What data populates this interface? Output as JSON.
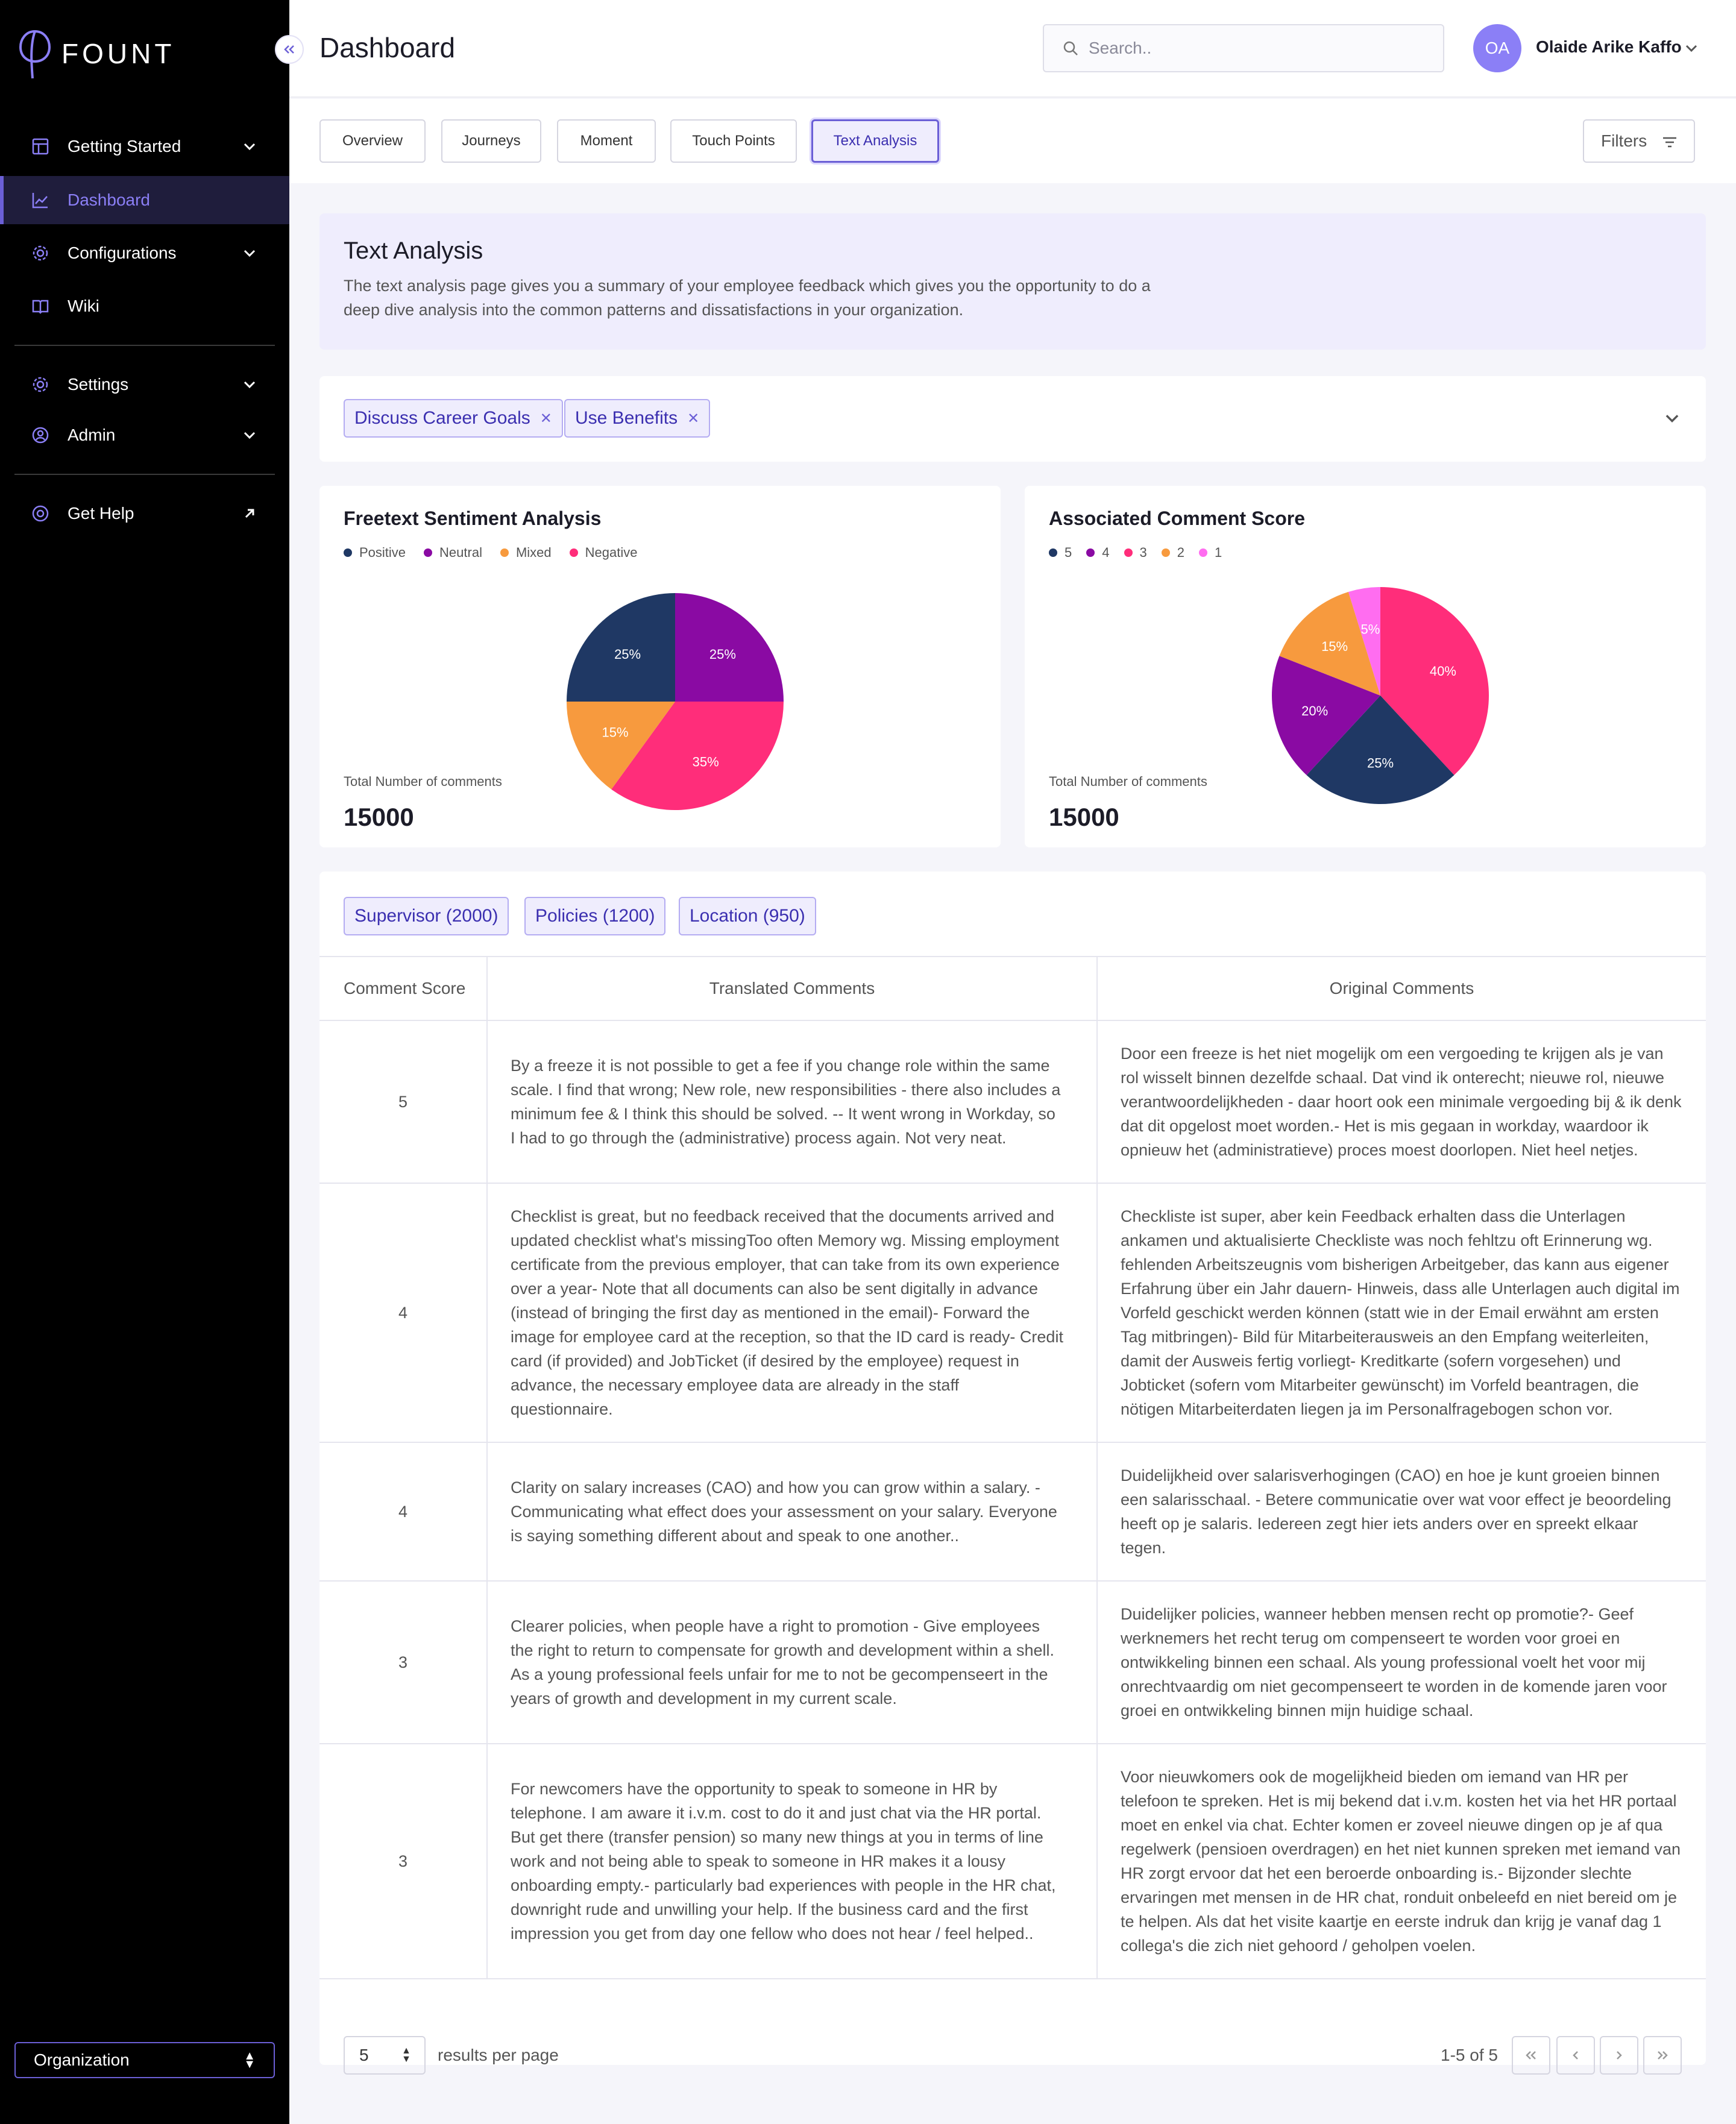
{
  "sidebar": {
    "logo_text": "FOUNT",
    "items": [
      {
        "label": "Getting Started"
      },
      {
        "label": "Dashboard"
      },
      {
        "label": "Configurations"
      },
      {
        "label": "Wiki"
      },
      {
        "label": "Settings"
      },
      {
        "label": "Admin"
      },
      {
        "label": "Get Help"
      }
    ],
    "org_select": "Organization"
  },
  "header": {
    "title": "Dashboard",
    "search_placeholder": "Search..",
    "avatar_initials": "OA",
    "user_name": "Olaide Arike Kaffo"
  },
  "tabs": [
    {
      "label": "Overview"
    },
    {
      "label": "Journeys"
    },
    {
      "label": "Moment"
    },
    {
      "label": "Touch Points"
    },
    {
      "label": "Text Analysis"
    }
  ],
  "filters_label": "Filters",
  "intro": {
    "title": "Text Analysis",
    "text": "The text analysis page gives you a summary of your employee feedback which gives you the opportunity to do a deep dive analysis into the common patterns and dissatisfactions in your organization."
  },
  "filter_chips": [
    "Discuss Career Goals",
    "Use Benefits"
  ],
  "chart_data": [
    {
      "type": "pie",
      "title": "Freetext Sentiment Analysis",
      "categories": [
        "Positive",
        "Neutral",
        "Mixed",
        "Negative"
      ],
      "values": [
        25,
        25,
        15,
        35
      ],
      "colors": [
        "#1f3864",
        "#8a0aa3",
        "#f79a3e",
        "#ff2d7a"
      ],
      "total_label": "Total Number of comments",
      "total": "15000"
    },
    {
      "type": "pie",
      "title": "Associated Comment Score",
      "categories": [
        "5",
        "4",
        "3",
        "2",
        "1"
      ],
      "values": [
        25,
        20,
        40,
        15,
        5
      ],
      "colors": [
        "#1f3864",
        "#8a0aa3",
        "#ff2d7a",
        "#f79a3e",
        "#ff6df0"
      ],
      "total_label": "Total Number of comments",
      "total": "15000"
    }
  ],
  "table": {
    "tags": [
      "Supervisor (2000)",
      "Policies (1200)",
      "Location (950)"
    ],
    "headers": [
      "Comment Score",
      "Translated Comments",
      "Original Comments"
    ],
    "rows": [
      {
        "score": "5",
        "translated": "By a freeze it is not possible to get a fee if you change role within the same scale. I find that wrong; New role, new responsibilities - there also includes a minimum fee & I think this should be solved. -- It went wrong in Workday, so I had to go through the (administrative) process again. Not very neat.",
        "original": "Door een freeze is het niet mogelijk om een vergoeding te krijgen als je van rol wisselt binnen dezelfde schaal. Dat vind ik onterecht; nieuwe rol, nieuwe verantwoordelijkheden - daar hoort ook een minimale vergoeding bij & ik denk dat dit opgelost moet worden.- Het is mis gegaan in workday, waardoor ik opnieuw het (administratieve) proces moest doorlopen. Niet heel netjes."
      },
      {
        "score": "4",
        "translated": "Checklist is great, but no feedback received that the documents arrived and updated checklist what's missingToo often Memory wg. Missing employment certificate from the previous employer, that can take from its own experience over a year- Note that all documents can also be sent digitally in advance (instead of bringing the first day as mentioned in the email)- Forward the image for employee card at the reception, so that the ID card is ready- Credit card (if provided) and JobTicket (if desired by the employee) request in advance, the necessary employee data are already in the staff questionnaire.",
        "original": "Checkliste ist super, aber kein Feedback erhalten dass die Unterlagen ankamen und aktualisierte Checkliste was noch fehltzu oft Erinnerung wg. fehlenden Arbeitszeugnis vom bisherigen Arbeitgeber, das kann aus eigener Erfahrung über ein Jahr dauern- Hinweis, dass alle Unterlagen auch digital im Vorfeld geschickt werden können (statt wie in der Email erwähnt am ersten Tag mitbringen)- Bild für Mitarbeiterausweis an den Empfang weiterleiten, damit der Ausweis fertig vorliegt- Kreditkarte (sofern vorgesehen) und Jobticket (sofern vom Mitarbeiter gewünscht) im Vorfeld beantragen, die nötigen Mitarbeiterdaten liegen ja im Personalfragebogen schon vor."
      },
      {
        "score": "4",
        "translated": "Clarity on salary increases (CAO) and how you can grow within a salary. - Communicating what effect does your assessment on your salary. Everyone is saying something different about and speak to one another..",
        "original": "Duidelijkheid over salarisverhogingen (CAO) en hoe je kunt groeien binnen een salarisschaal. - Betere communicatie over wat voor effect je beoordeling heeft op je salaris. Iedereen zegt hier iets anders over en spreekt elkaar tegen."
      },
      {
        "score": "3",
        "translated": "Clearer policies, when people have a right to promotion - Give employees the right to return to compensate for growth and development within a shell. As a young professional feels unfair for me to not be gecompenseert in the years of growth and development in my current scale.",
        "original": "Duidelijker policies, wanneer hebben mensen recht op promotie?- Geef werknemers het recht terug om compenseert te worden voor groei en ontwikkeling binnen een schaal. Als young professional voelt het voor mij onrechtvaardig om niet gecompenseert te worden in de komende jaren voor groei en ontwikkeling binnen mijn huidige schaal."
      },
      {
        "score": "3",
        "translated": "For newcomers have the opportunity to speak to someone in HR by telephone. I am aware it i.v.m. cost to do it and just chat via the HR portal. But get there (transfer pension) so many new things at you in terms of line work and not being able to speak to someone in HR makes it a lousy onboarding empty.- particularly bad experiences with people in the HR chat, downright rude and unwilling your help. If the business card and the first impression you get from day one fellow who does not hear / feel helped..",
        "original": "Voor nieuwkomers ook de mogelijkheid bieden om iemand van HR per telefoon te spreken. Het is mij bekend dat i.v.m. kosten het via het HR portaal moet en enkel via chat. Echter komen er zoveel nieuwe dingen op je af qua regelwerk (pensioen overdragen) en het niet kunnen spreken met iemand van HR zorgt ervoor dat het een beroerde onboarding is.- Bijzonder slechte ervaringen met mensen in de HR chat, ronduit onbeleefd en niet bereid om je te helpen. Als dat het visite kaartje en eerste indruk dan krijg je vanaf dag 1 collega's die zich niet gehoord / geholpen voelen."
      }
    ]
  },
  "pagination": {
    "per_page": "5",
    "per_page_label": "results per page",
    "info": "1-5 of 5"
  }
}
